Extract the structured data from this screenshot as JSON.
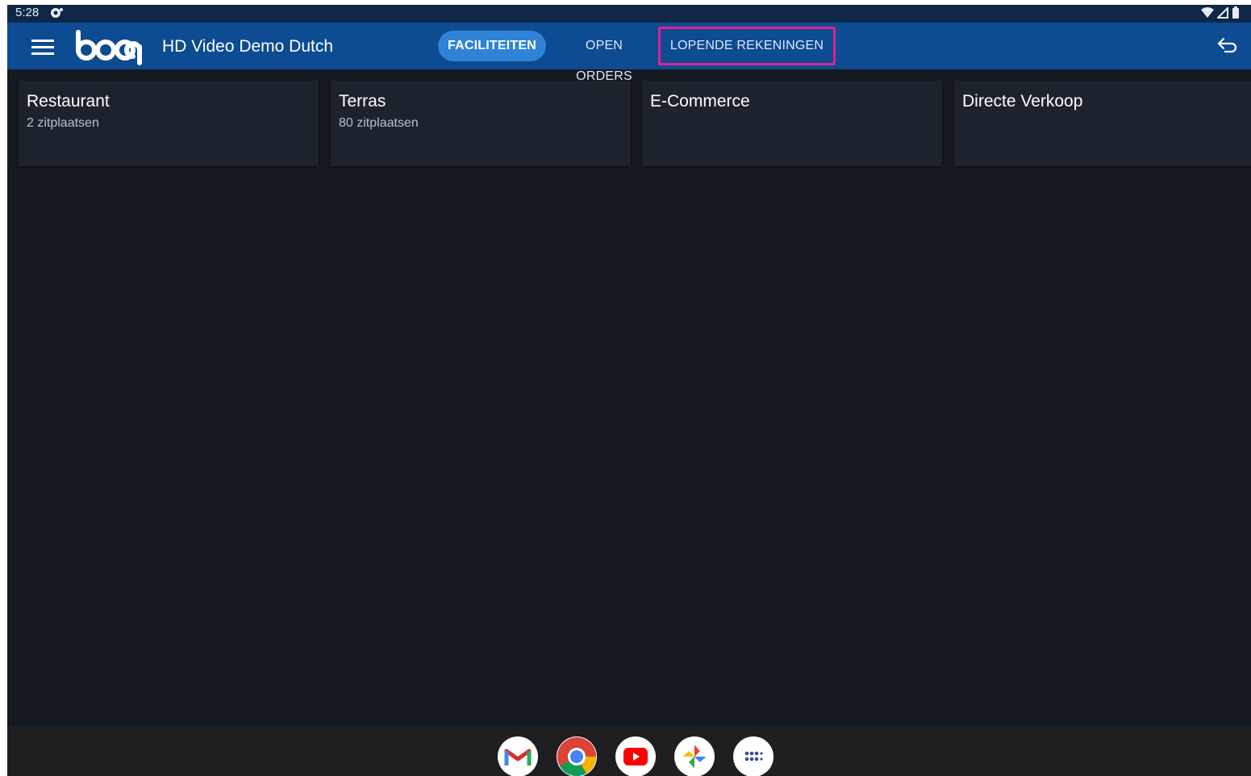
{
  "status_bar": {
    "time": "5:28"
  },
  "app_bar": {
    "logo_text": "booq",
    "title": "HD Video Demo Dutch",
    "tabs": [
      {
        "label": "FACILITEITEN",
        "active": true
      },
      {
        "label": "OPEN ORDERS",
        "active": false
      },
      {
        "label": "LOPENDE REKENINGEN",
        "active": false,
        "highlighted": true
      }
    ]
  },
  "facilities": [
    {
      "name": "Restaurant",
      "seats": "2 zitplaatsen"
    },
    {
      "name": "Terras",
      "seats": "80 zitplaatsen"
    },
    {
      "name": "E-Commerce",
      "seats": ""
    },
    {
      "name": "Directe Verkoop",
      "seats": ""
    }
  ],
  "dock": {
    "apps": [
      "gmail-icon",
      "chrome-icon",
      "youtube-icon",
      "photos-icon",
      "app-drawer-icon"
    ]
  },
  "colors": {
    "app_bar": "#0d4b92",
    "active_tab": "#2e83d6",
    "highlight": "#e0208f",
    "background": "#151a21",
    "card": "#1c232d"
  }
}
